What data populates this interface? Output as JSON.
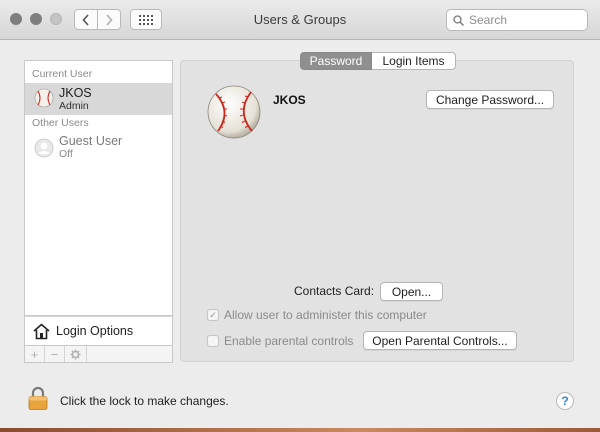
{
  "window": {
    "title": "Users & Groups"
  },
  "toolbar": {
    "search_placeholder": "Search",
    "icons": [
      "close-icon",
      "minimize-icon",
      "zoom-icon",
      "back-chevron-icon",
      "forward-chevron-icon",
      "grid-icon",
      "search-icon"
    ]
  },
  "sidebar": {
    "current_user_header": "Current User",
    "other_users_header": "Other Users",
    "users": [
      {
        "name": "JKOS",
        "role": "Admin",
        "selected": true,
        "icon": "baseball-avatar-icon"
      },
      {
        "name": "Guest User",
        "role": "Off",
        "selected": false,
        "icon": "guest-avatar-icon"
      }
    ],
    "login_options_label": "Login Options",
    "controls": [
      "+",
      "−",
      "gear-icon"
    ]
  },
  "tabs": [
    {
      "label": "Password",
      "active": true
    },
    {
      "label": "Login Items",
      "active": false
    }
  ],
  "user_panel": {
    "username": "JKOS",
    "change_password_label": "Change Password...",
    "contacts_card_label": "Contacts Card:",
    "open_label": "Open...",
    "allow_admin_label": "Allow user to administer this computer",
    "allow_admin_checked": true,
    "parental_controls_label": "Enable parental controls",
    "parental_controls_checked": false,
    "open_parental_label": "Open Parental Controls..."
  },
  "footer": {
    "lock_text": "Click the lock to make changes.",
    "help_label": "?"
  },
  "colors": {
    "tab_active_bg": "#8f8f8f",
    "panel_bg": "#e2e2e2",
    "selected_row_bg": "#d8d8d8",
    "lock_gold": "#e8a33c",
    "help_blue": "#3a82d8"
  }
}
